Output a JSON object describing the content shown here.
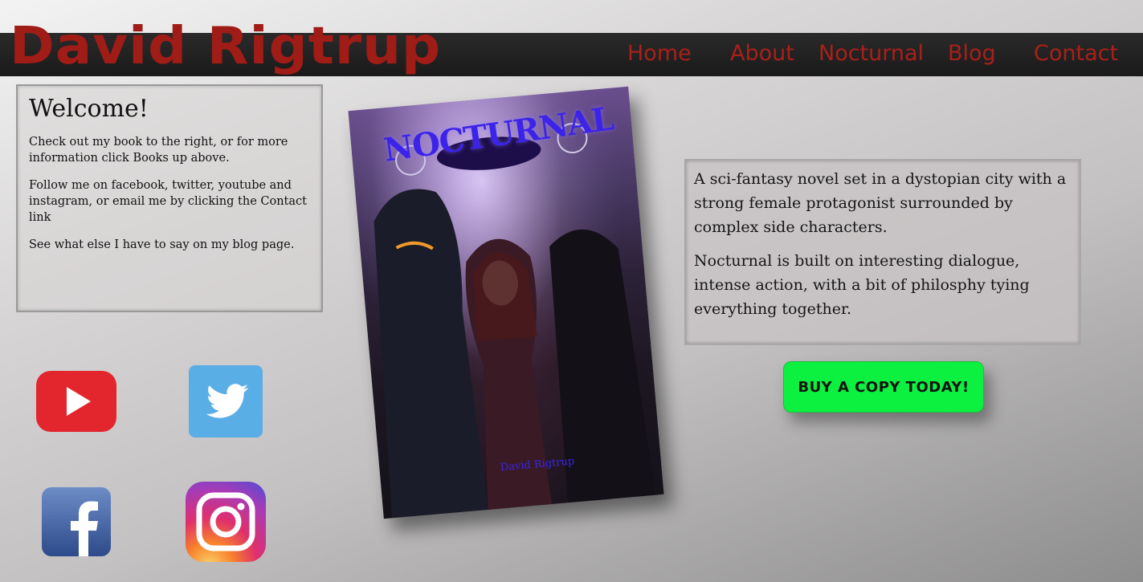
{
  "header": {
    "site_title": "David Rigtrup",
    "nav": [
      "Home",
      "About",
      "Nocturnal",
      "Blog",
      "Contact"
    ]
  },
  "welcome": {
    "heading": "Welcome!",
    "paragraphs": [
      "Check out my book to the right, or for more information click Books up above.",
      "Follow me on facebook, twitter, youtube and instagram, or email me by clicking the Contact link",
      "See what else I have to say on my blog page."
    ]
  },
  "book": {
    "cover_title": "NOCTURNAL",
    "cover_author": "David Rigtrup",
    "description": [
      "A sci-fantasy novel set in a dystopian city with a strong female protagonist surrounded by complex side characters.",
      "Nocturnal is built on interesting dialogue, intense action, with a bit of philosphy tying everything together."
    ],
    "buy_label": "BUY A COPY TODAY!"
  },
  "social": {
    "icons": [
      "youtube-icon",
      "twitter-icon",
      "facebook-icon",
      "instagram-icon"
    ]
  },
  "colors": {
    "title_red": "#a01c16",
    "nav_bar": "#1f1f1f",
    "buy_green": "#0cf040",
    "cover_title_blue": "#3b24e8"
  }
}
